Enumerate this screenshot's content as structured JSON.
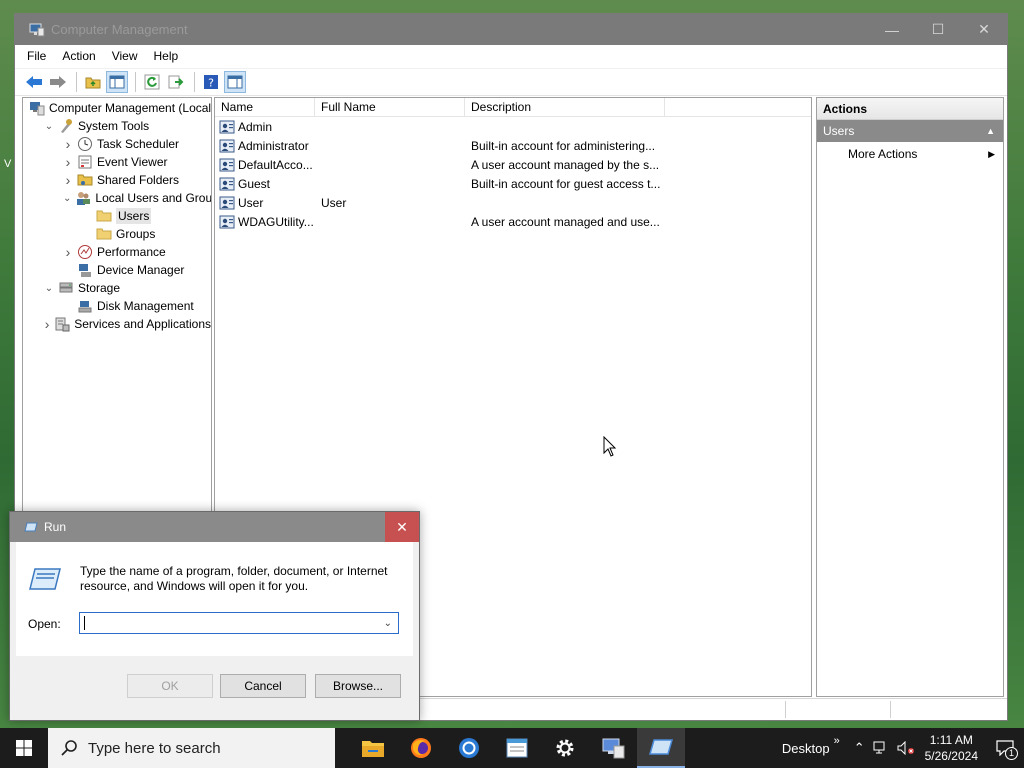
{
  "window": {
    "title": "Computer Management"
  },
  "menu": [
    "File",
    "Action",
    "View",
    "Help"
  ],
  "tree": [
    {
      "label": "Computer Management (Local",
      "icon": "computer-management-icon",
      "level": 0,
      "twisty": ""
    },
    {
      "label": "System Tools",
      "icon": "system-tools-icon",
      "level": 1,
      "twisty": "expanded"
    },
    {
      "label": "Task Scheduler",
      "icon": "clock-icon",
      "level": 2,
      "twisty": "collapsed"
    },
    {
      "label": "Event Viewer",
      "icon": "event-viewer-icon",
      "level": 2,
      "twisty": "collapsed"
    },
    {
      "label": "Shared Folders",
      "icon": "shared-folder-icon",
      "level": 2,
      "twisty": "collapsed"
    },
    {
      "label": "Local Users and Groups",
      "icon": "users-groups-icon",
      "level": 2,
      "twisty": "expanded"
    },
    {
      "label": "Users",
      "icon": "folder-icon",
      "level": 3,
      "twisty": "",
      "selected": true
    },
    {
      "label": "Groups",
      "icon": "folder-icon",
      "level": 3,
      "twisty": ""
    },
    {
      "label": "Performance",
      "icon": "performance-icon",
      "level": 2,
      "twisty": "collapsed"
    },
    {
      "label": "Device Manager",
      "icon": "device-manager-icon",
      "level": 2,
      "twisty": ""
    },
    {
      "label": "Storage",
      "icon": "storage-icon",
      "level": 1,
      "twisty": "expanded"
    },
    {
      "label": "Disk Management",
      "icon": "disk-icon",
      "level": 2,
      "twisty": ""
    },
    {
      "label": "Services and Applications",
      "icon": "services-icon",
      "level": 1,
      "twisty": "collapsed"
    }
  ],
  "list": {
    "columns": [
      "Name",
      "Full Name",
      "Description"
    ],
    "rows": [
      {
        "name": "Admin",
        "full": "",
        "desc": ""
      },
      {
        "name": "Administrator",
        "full": "",
        "desc": "Built-in account for administering..."
      },
      {
        "name": "DefaultAcco...",
        "full": "",
        "desc": "A user account managed by the s..."
      },
      {
        "name": "Guest",
        "full": "",
        "desc": "Built-in account for guest access t..."
      },
      {
        "name": "User",
        "full": "User",
        "desc": ""
      },
      {
        "name": "WDAGUtility...",
        "full": "",
        "desc": "A user account managed and use..."
      }
    ]
  },
  "actions": {
    "header": "Actions",
    "section": "Users",
    "more": "More Actions"
  },
  "run": {
    "title": "Run",
    "prompt": "Type the name of a program, folder, document, or Internet resource, and Windows will open it for you.",
    "open_label": "Open:",
    "open_value": "",
    "ok": "OK",
    "cancel": "Cancel",
    "browse": "Browse..."
  },
  "taskbar": {
    "search_placeholder": "Type here to search",
    "desktop_label": "Desktop",
    "time": "1:11 AM",
    "date": "5/26/2024",
    "notification_count": "1"
  }
}
